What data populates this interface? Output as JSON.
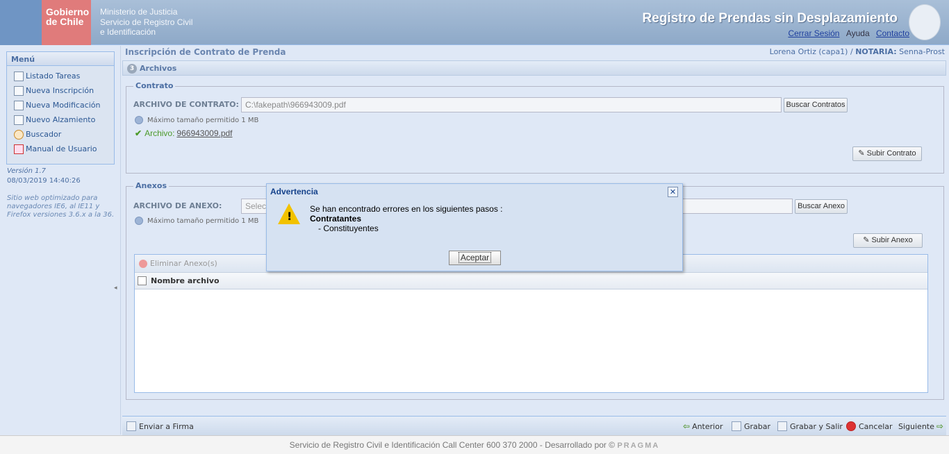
{
  "header": {
    "gov_line1": "Gobierno",
    "gov_line2": "de Chile",
    "ministry_l1": "Ministerio de Justicia",
    "ministry_l2": "Servicio de Registro Civil",
    "ministry_l3": "e Identificación",
    "app_title": "Registro de Prendas sin Desplazamiento",
    "logout": "Cerrar Sesión",
    "help": "Ayuda",
    "contact": "Contacto"
  },
  "menu": {
    "title": "Menú",
    "items": [
      {
        "label": "Listado Tareas"
      },
      {
        "label": "Nueva Inscripción"
      },
      {
        "label": "Nueva Modificación"
      },
      {
        "label": "Nuevo Alzamiento"
      },
      {
        "label": "Buscador"
      },
      {
        "label": "Manual de Usuario"
      }
    ],
    "version": "Versión 1.7",
    "date": "08/03/2019 14:40:26",
    "note": "Sitio web optimizado para navegadores IE6, al IE11 y Firefox versiones 3.6.x a la 36."
  },
  "main": {
    "title": "Inscripción de Contrato de Prenda",
    "user": "Lorena Ortiz (capa1) /",
    "notaria_label": "NOTARIA:",
    "notaria": "Senna-Prost",
    "step_num": "3",
    "section": "Archivos"
  },
  "contrato": {
    "legend": "Contrato",
    "label": "ARCHIVO DE CONTRATO:",
    "value": "C:\\fakepath\\966943009.pdf",
    "browse": "Buscar Contratos",
    "max": "Máximo tamaño permitido 1 MB",
    "archivo_label": "Archivo:",
    "archivo_name": "966943009.pdf",
    "upload": "Subir Contrato"
  },
  "anexos": {
    "legend": "Anexos",
    "label": "ARCHIVO DE ANEXO:",
    "placeholder": "Selecc",
    "browse": "Buscar Anexo",
    "max": "Máximo tamaño permitido 1 MB",
    "upload": "Subir Anexo",
    "delete": "Eliminar Anexo(s)",
    "col_name": "Nombre archivo"
  },
  "bottom": {
    "send": "Enviar a Firma",
    "prev": "Anterior",
    "save": "Grabar",
    "save_exit": "Grabar y Salir",
    "cancel": "Cancelar",
    "next": "Siguiente"
  },
  "footer": {
    "text": "Servicio de Registro Civil e Identificación   Call Center 600 370 2000 - Desarrollado por ©",
    "brand": "PRAGMA"
  },
  "dialog": {
    "title": "Advertencia",
    "message": "Se han encontrado errores en los siguientes pasos :",
    "step": "Contratantes",
    "sub": "- Constituyentes",
    "ok": "Aceptar"
  }
}
